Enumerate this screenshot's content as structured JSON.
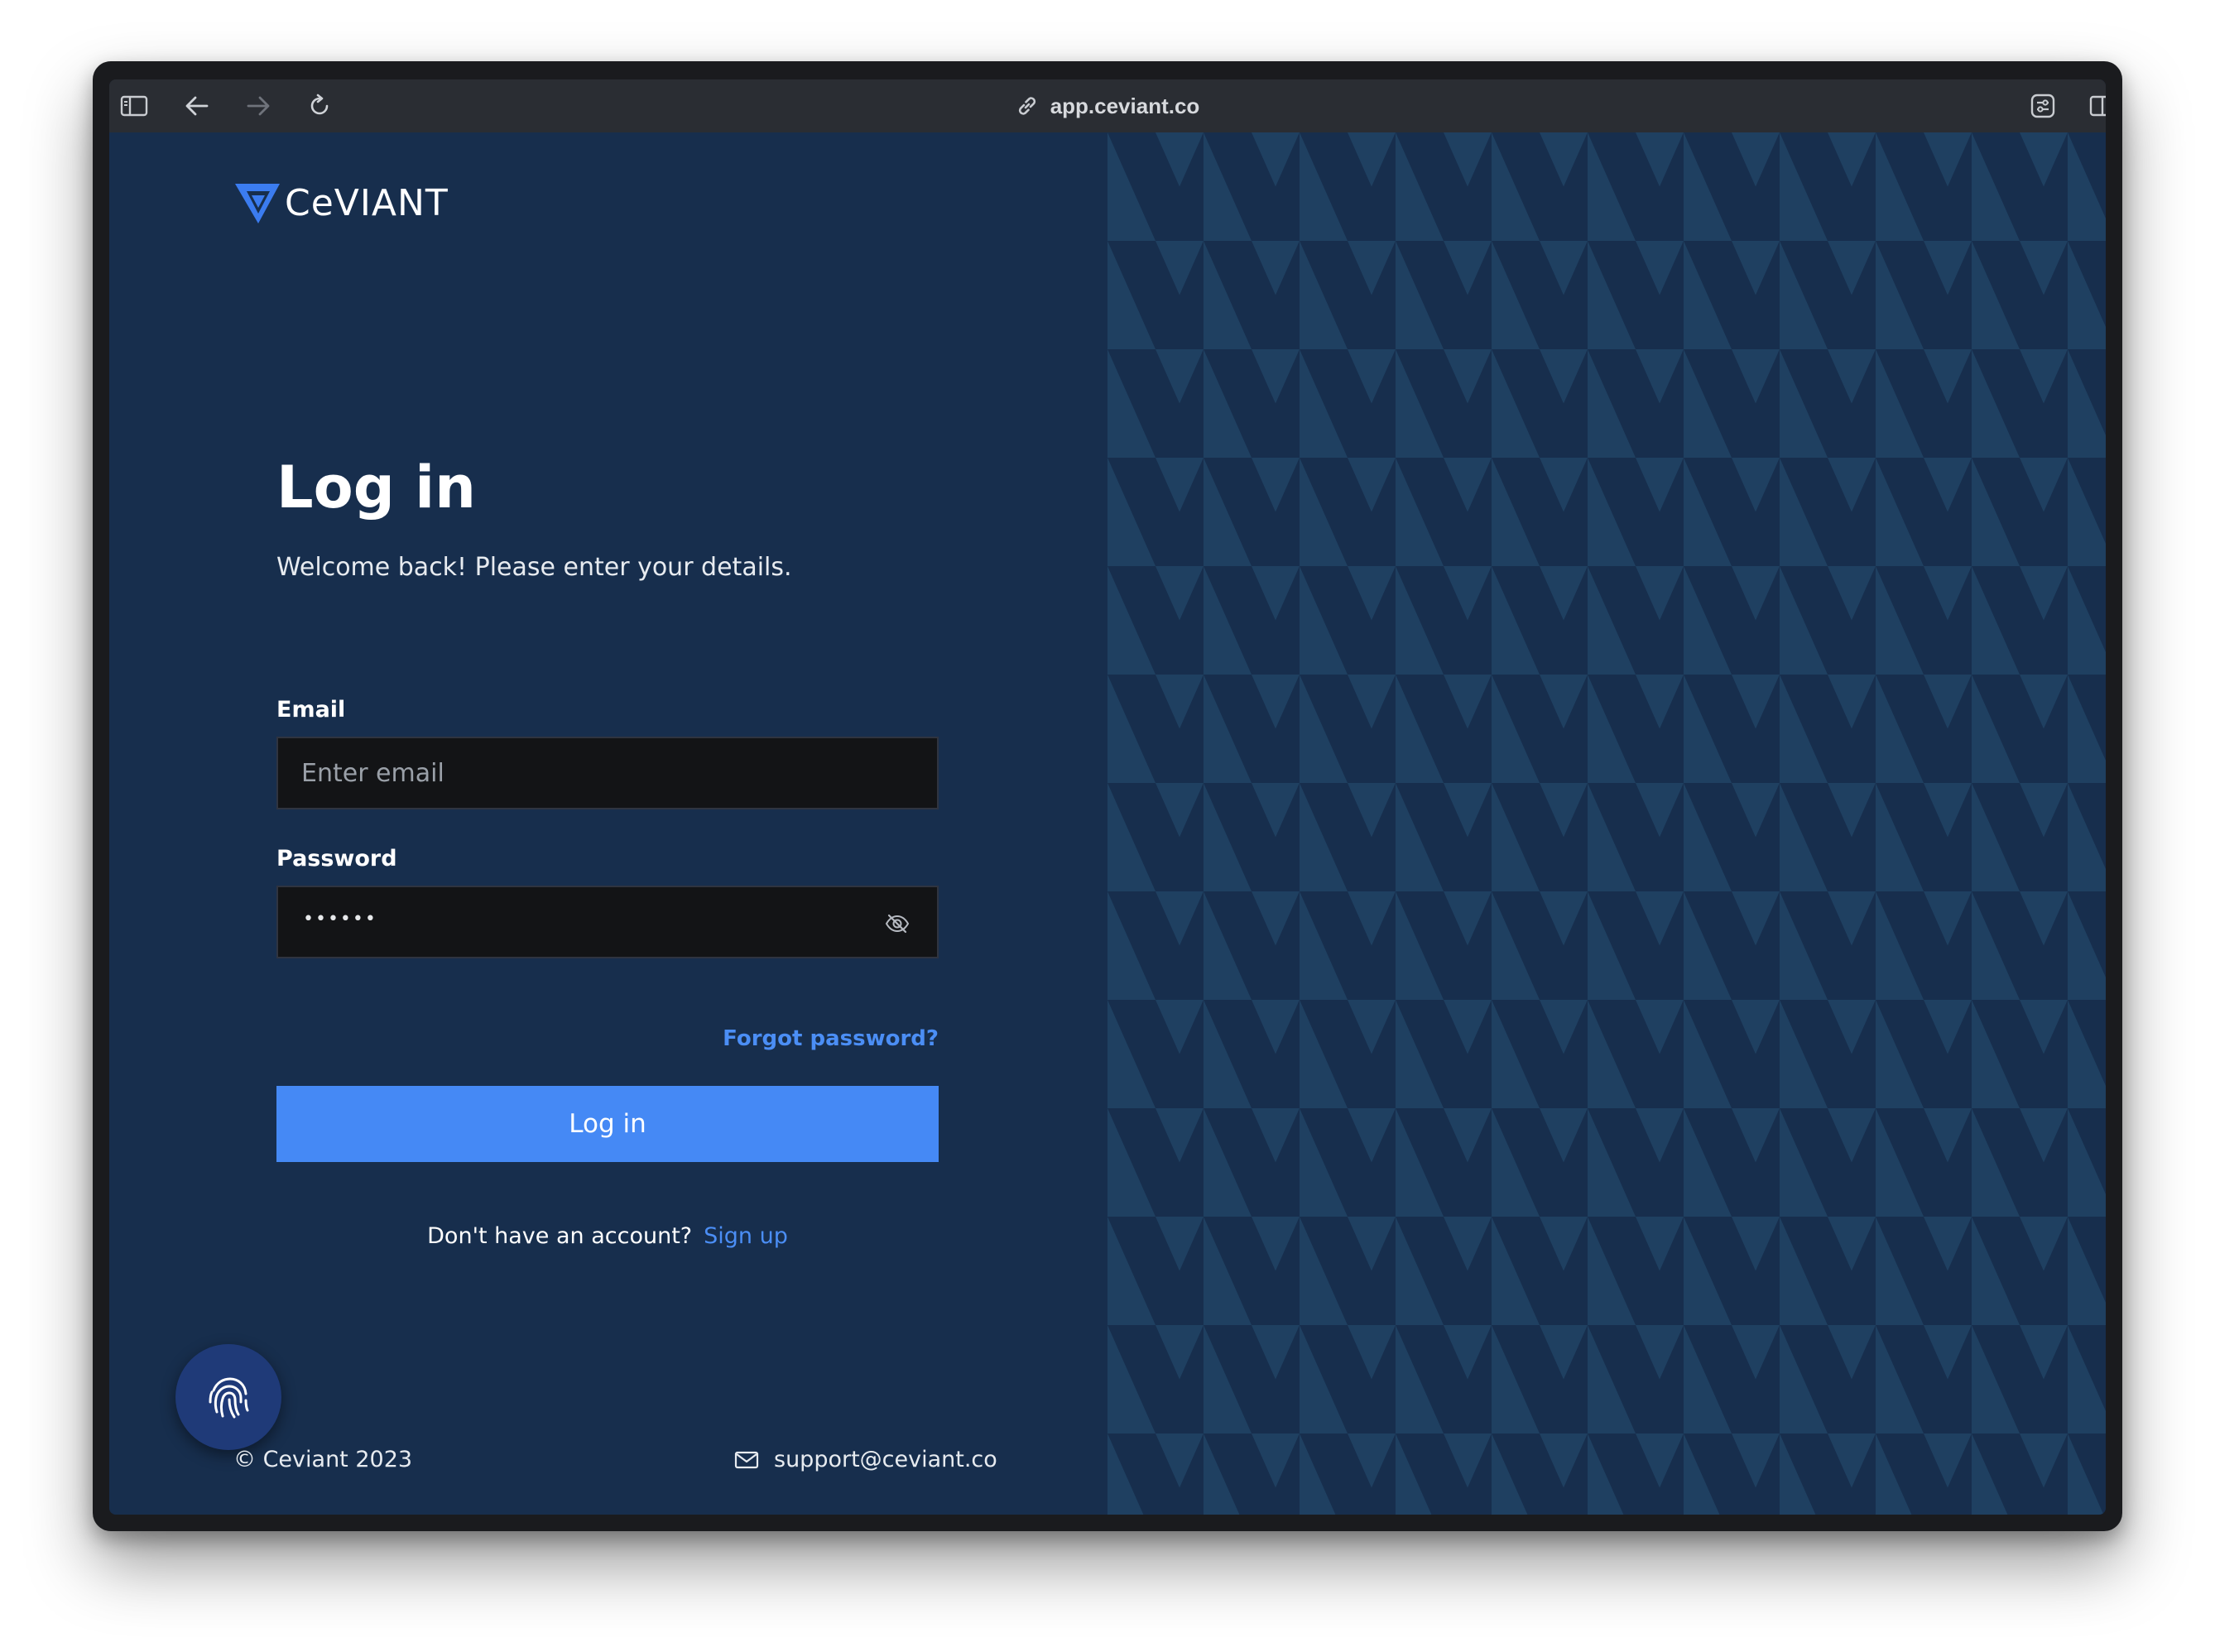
{
  "browser": {
    "url": "app.ceviant.co",
    "icons": {
      "sidebar": "sidebar-icon",
      "back": "back-arrow-icon",
      "forward": "forward-arrow-icon",
      "reload": "reload-icon",
      "link": "link-icon",
      "extension": "extension-icon",
      "split_view": "split-view-icon"
    }
  },
  "brand": {
    "name": "CeVIANT",
    "logo_icon": "ceviant-logo-icon",
    "colors": {
      "background": "#172e4d",
      "pattern": "#1f4061",
      "accent": "#4589f5",
      "link": "#4b8ef5",
      "input_bg": "#131416"
    }
  },
  "login": {
    "title": "Log in",
    "subtitle": "Welcome back! Please enter your details.",
    "email": {
      "label": "Email",
      "placeholder": "Enter email",
      "value": ""
    },
    "password": {
      "label": "Password",
      "masked_value": "••••••",
      "toggle_icon": "eye-off-icon"
    },
    "forgot_link": "Forgot password?",
    "submit_label": "Log in",
    "signup_prompt": "Don't have an account?",
    "signup_link": "Sign up"
  },
  "fab": {
    "icon": "fingerprint-icon"
  },
  "footer": {
    "copyright": "© Ceviant 2023",
    "support_email": "support@ceviant.co",
    "mail_icon": "mail-icon"
  }
}
